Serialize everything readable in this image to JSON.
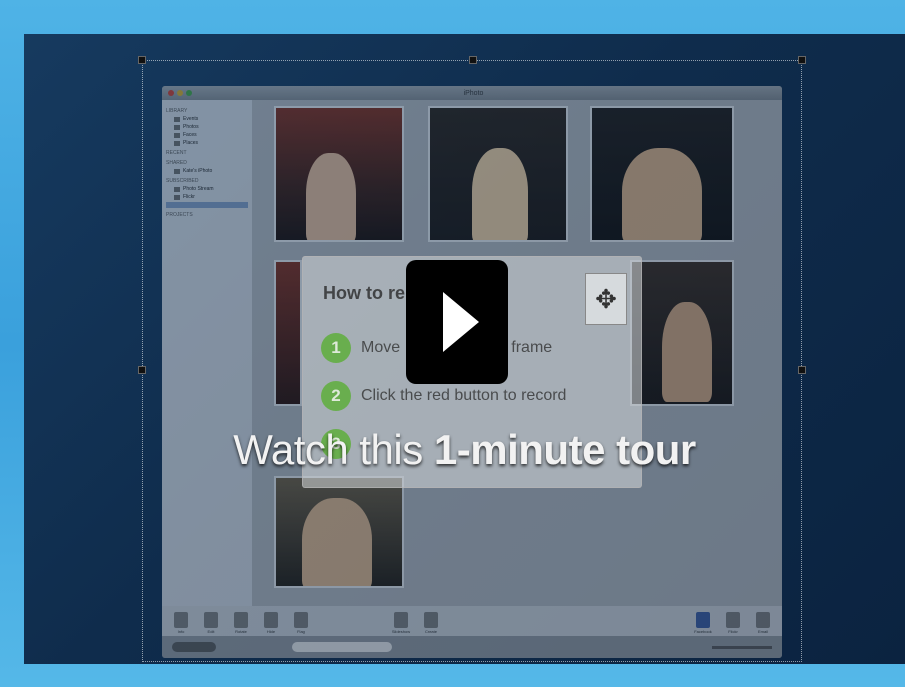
{
  "colors": {
    "page_background": "#4fb3e6",
    "video_background": "#0f2c4c",
    "play_button": "#000000",
    "step_badge": "#5fae3c",
    "caption_text": "#f2f2f2"
  },
  "video": {
    "caption_prefix": "Watch this ",
    "caption_emphasis": "1-minute tour",
    "play_icon": "play-icon"
  },
  "app_window": {
    "title": "iPhoto",
    "sidebar": {
      "sections": [
        {
          "header": "Library",
          "items": [
            "Events",
            "Photos",
            "Faces",
            "Places"
          ]
        },
        {
          "header": "Recent",
          "items": []
        },
        {
          "header": "Shared",
          "items": [
            "Kate's iPhoto"
          ]
        },
        {
          "header": "Subscribed",
          "items": [
            "Photo Stream",
            "Flickr"
          ]
        },
        {
          "header": "Projects",
          "items": []
        }
      ]
    },
    "toolbar": [
      "Info",
      "Edit",
      "Rotate",
      "Hide",
      "Flag",
      "Slideshow",
      "Create",
      "Facebook",
      "Flickr",
      "Email"
    ]
  },
  "howto": {
    "title": "How to re",
    "steps": [
      {
        "num": "1",
        "text": "Move                      e frame"
      },
      {
        "num": "2",
        "text": "Click the red button to record"
      },
      {
        "num": "3",
        "text": ""
      }
    ],
    "move_icon": "move-arrows-icon"
  }
}
